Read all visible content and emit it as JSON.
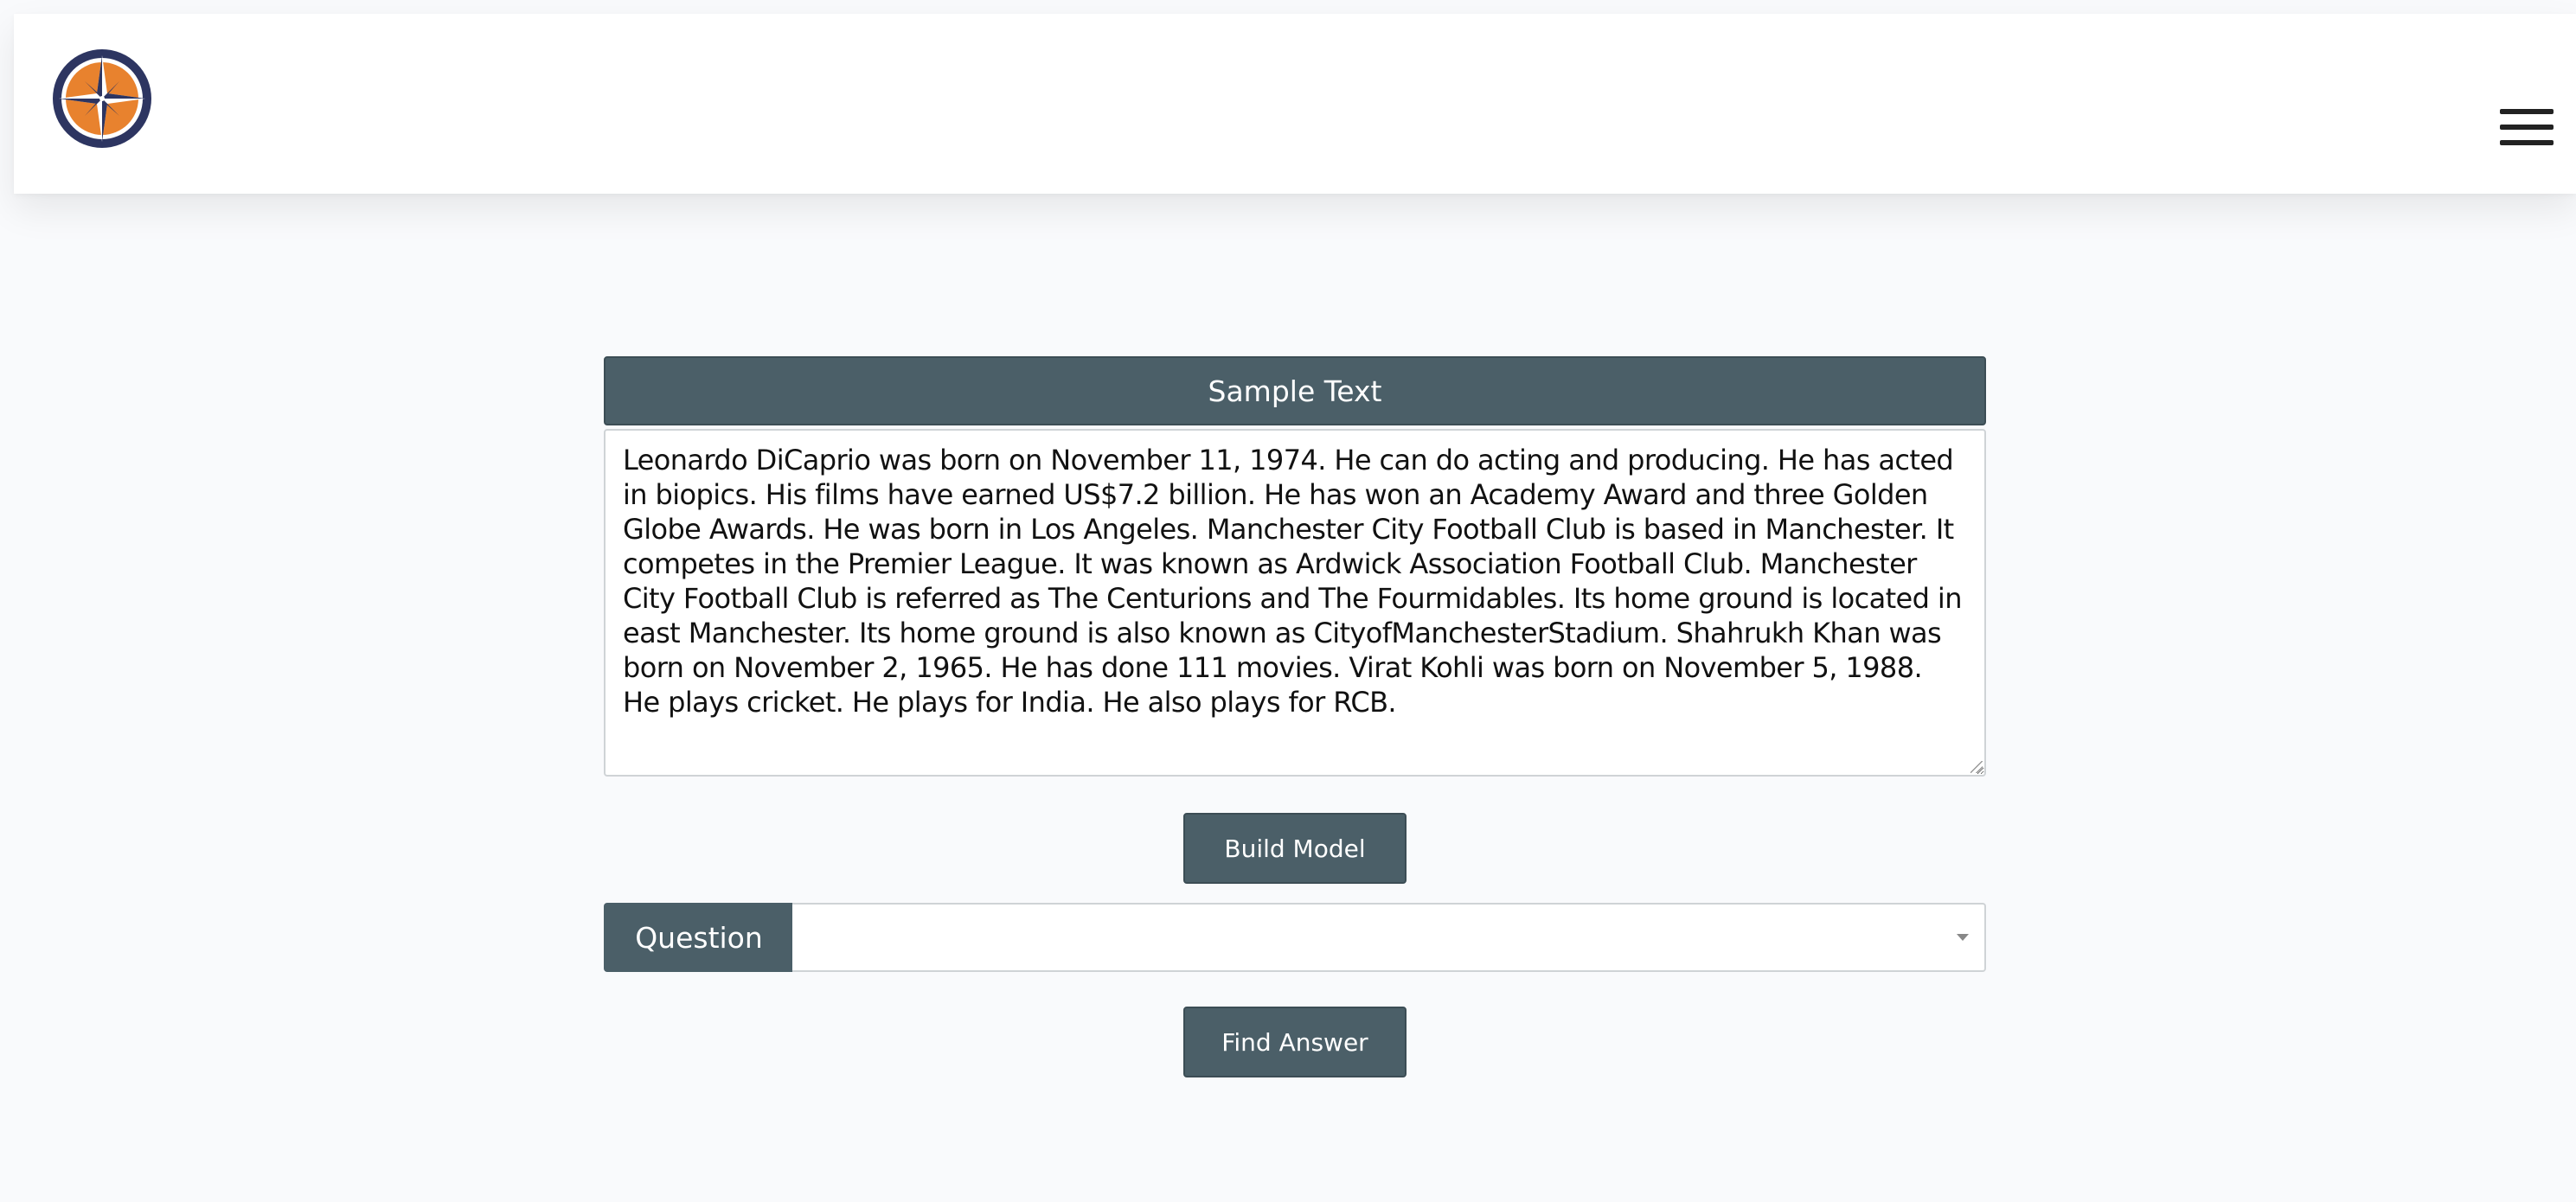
{
  "header": {
    "logo_icon": "compass-logo-icon",
    "menu_icon": "hamburger-menu-icon"
  },
  "sample_card": {
    "title": "Sample Text",
    "text": "Leonardo DiCaprio was born on November 11, 1974. He can do acting and producing. He has acted in biopics. His films have earned US$7.2 billion. He has won an Academy Award and three Golden Globe Awards. He was born in Los Angeles. Manchester City Football Club is based in Manchester. It competes in the Premier League. It was known as Ardwick Association Football Club. Manchester City Football Club is referred as The Centurions and The Fourmidables. Its home ground is located in east Manchester. Its home ground is also known as CityofManchesterStadium. Shahrukh Khan was born on November 2, 1965. He has done 111 movies. Virat Kohli was born on November 5, 1988. He plays cricket. He plays for India. He also plays for RCB."
  },
  "actions": {
    "build_label": "Build Model",
    "find_label": "Find Answer"
  },
  "question": {
    "label": "Question",
    "selected": "",
    "caret_icon": "caret-down-icon"
  },
  "colors": {
    "accent": "#4b5f68",
    "background": "#f9fafc",
    "logo_orange": "#e8822e",
    "logo_navy": "#2d3561"
  }
}
